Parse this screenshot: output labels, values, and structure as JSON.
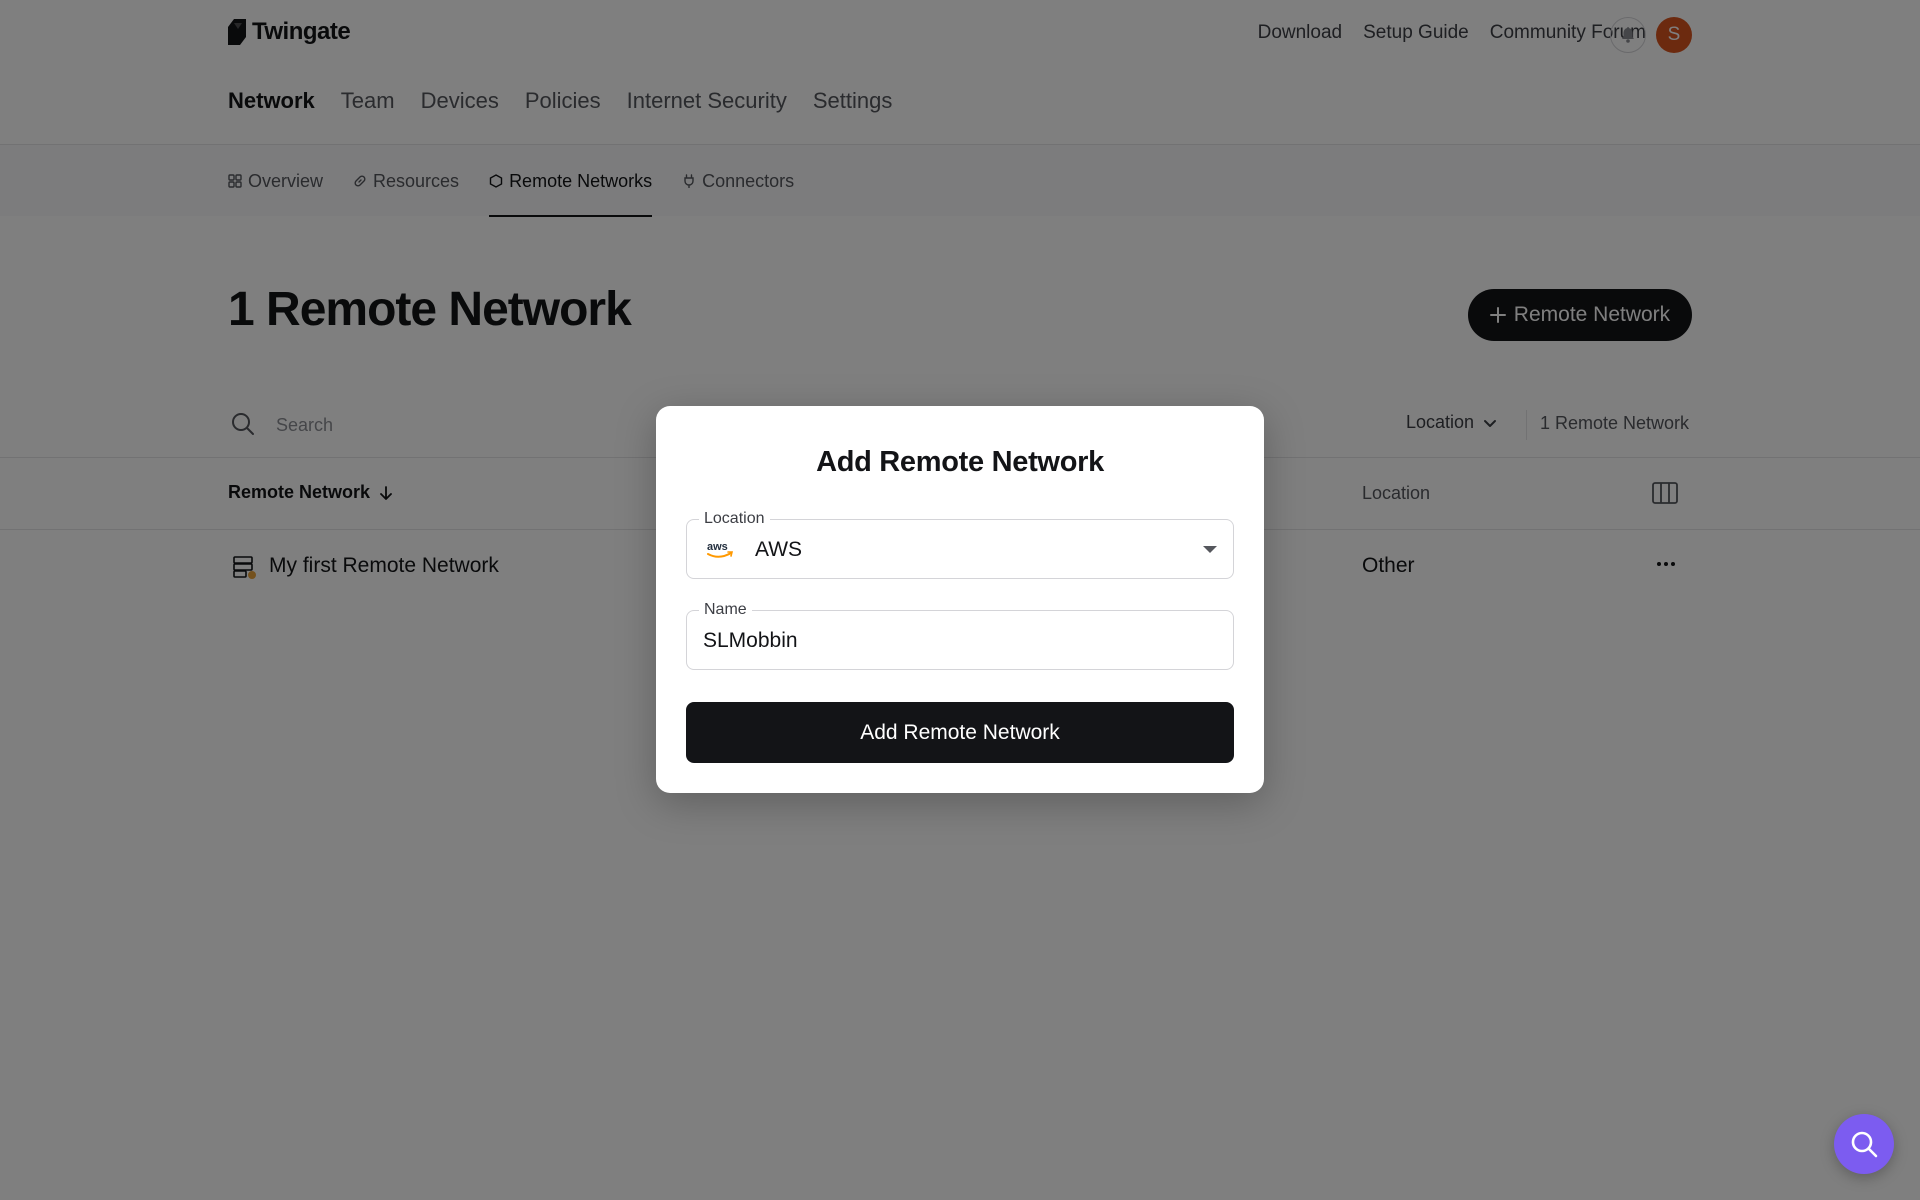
{
  "app": {
    "logo_text": "Twingate"
  },
  "header": {
    "links": [
      "Download",
      "Setup Guide",
      "Community Forum"
    ],
    "avatar_initial": "S",
    "avatar_color": "#d9551f"
  },
  "main_nav": {
    "items": [
      {
        "label": "Network",
        "active": true
      },
      {
        "label": "Team",
        "active": false
      },
      {
        "label": "Devices",
        "active": false
      },
      {
        "label": "Policies",
        "active": false
      },
      {
        "label": "Internet Security",
        "active": false
      },
      {
        "label": "Settings",
        "active": false
      }
    ]
  },
  "sub_nav": {
    "items": [
      {
        "label": "Overview",
        "icon": "grid-icon",
        "active": false
      },
      {
        "label": "Resources",
        "icon": "link-icon",
        "active": false
      },
      {
        "label": "Remote Networks",
        "icon": "hexagon-icon",
        "active": true
      },
      {
        "label": "Connectors",
        "icon": "plug-icon",
        "active": false
      }
    ]
  },
  "page": {
    "title": "1 Remote Network",
    "add_button_label": "Remote Network"
  },
  "toolbar": {
    "search_placeholder": "Search",
    "location_filter_label": "Location",
    "count_label": "1 Remote Network"
  },
  "table": {
    "columns": [
      "Remote Network",
      "Location"
    ],
    "rows": [
      {
        "name": "My first Remote Network",
        "location": "Other",
        "status_color": "#e9a23b"
      }
    ]
  },
  "modal": {
    "title": "Add Remote Network",
    "location_label": "Location",
    "location_value": "AWS",
    "location_icon": "aws-icon",
    "name_label": "Name",
    "name_value": "SLMobbin",
    "submit_label": "Add Remote Network"
  },
  "colors": {
    "primary": "#131417",
    "help_fab": "#7c5cf0",
    "overlay": "rgba(0,0,0,0.5)"
  }
}
